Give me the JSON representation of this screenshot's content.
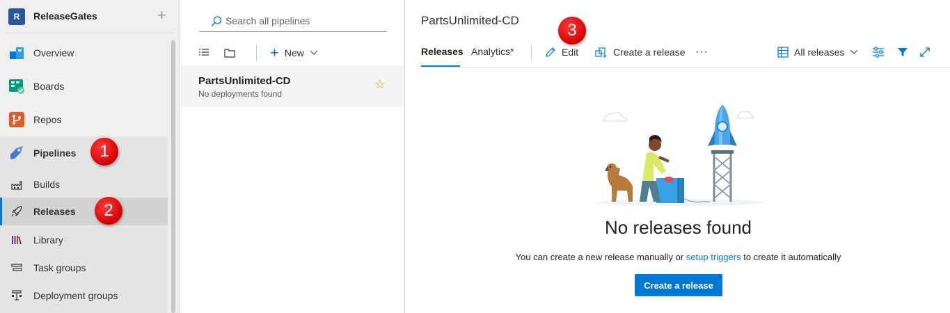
{
  "org": {
    "badge": "R",
    "name": "ReleaseGates"
  },
  "nav": {
    "items": [
      {
        "label": "Overview"
      },
      {
        "label": "Boards"
      },
      {
        "label": "Repos"
      },
      {
        "label": "Pipelines"
      },
      {
        "label": "Builds"
      },
      {
        "label": "Releases"
      },
      {
        "label": "Library"
      },
      {
        "label": "Task groups"
      },
      {
        "label": "Deployment groups"
      }
    ],
    "selected": "Releases"
  },
  "callouts": [
    "1",
    "2",
    "3"
  ],
  "pipelines_list": {
    "search_placeholder": "Search all pipelines",
    "new_label": "New",
    "items": [
      {
        "title": "PartsUnlimited-CD",
        "subtitle": "No deployments found",
        "favorite": true
      }
    ]
  },
  "main": {
    "title": "PartsUnlimited-CD",
    "tabs": [
      "Releases",
      "Analytics*"
    ],
    "active_tab": "Releases",
    "toolbar": {
      "edit_label": "Edit",
      "create_label": "Create a release",
      "more_label": "···",
      "view_selector": "All releases"
    },
    "empty_state": {
      "title": "No releases found",
      "text_before": "You can create a new release manually or ",
      "link": "setup triggers",
      "text_after": " to create it automatically",
      "button": "Create a release"
    }
  },
  "colors": {
    "accent": "#0078d4",
    "callout": "#e00000",
    "nav_bg": "#efefef"
  }
}
